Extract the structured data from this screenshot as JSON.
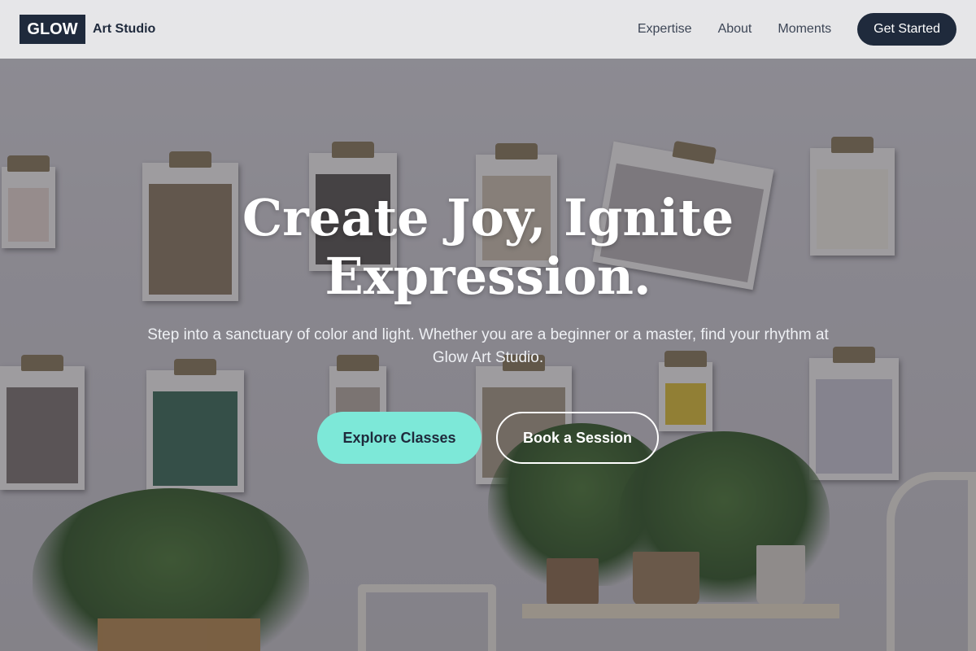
{
  "nav": {
    "logo_mark": "GLOW",
    "logo_text": "Art Studio",
    "links": [
      "Expertise",
      "About",
      "Moments"
    ],
    "cta_label": "Get Started"
  },
  "hero": {
    "title": "Create Joy, Ignite Expression.",
    "subtitle": "Step into a sanctuary of color and light. Whether you are a beginner or a master, find your rhythm at Glow Art Studio.",
    "primary_button": "Explore Classes",
    "secondary_button": "Book a Session"
  },
  "colors": {
    "brand_dark": "#1f2a3c",
    "accent_mint": "#7de8d8",
    "text_light": "#ffffff"
  }
}
